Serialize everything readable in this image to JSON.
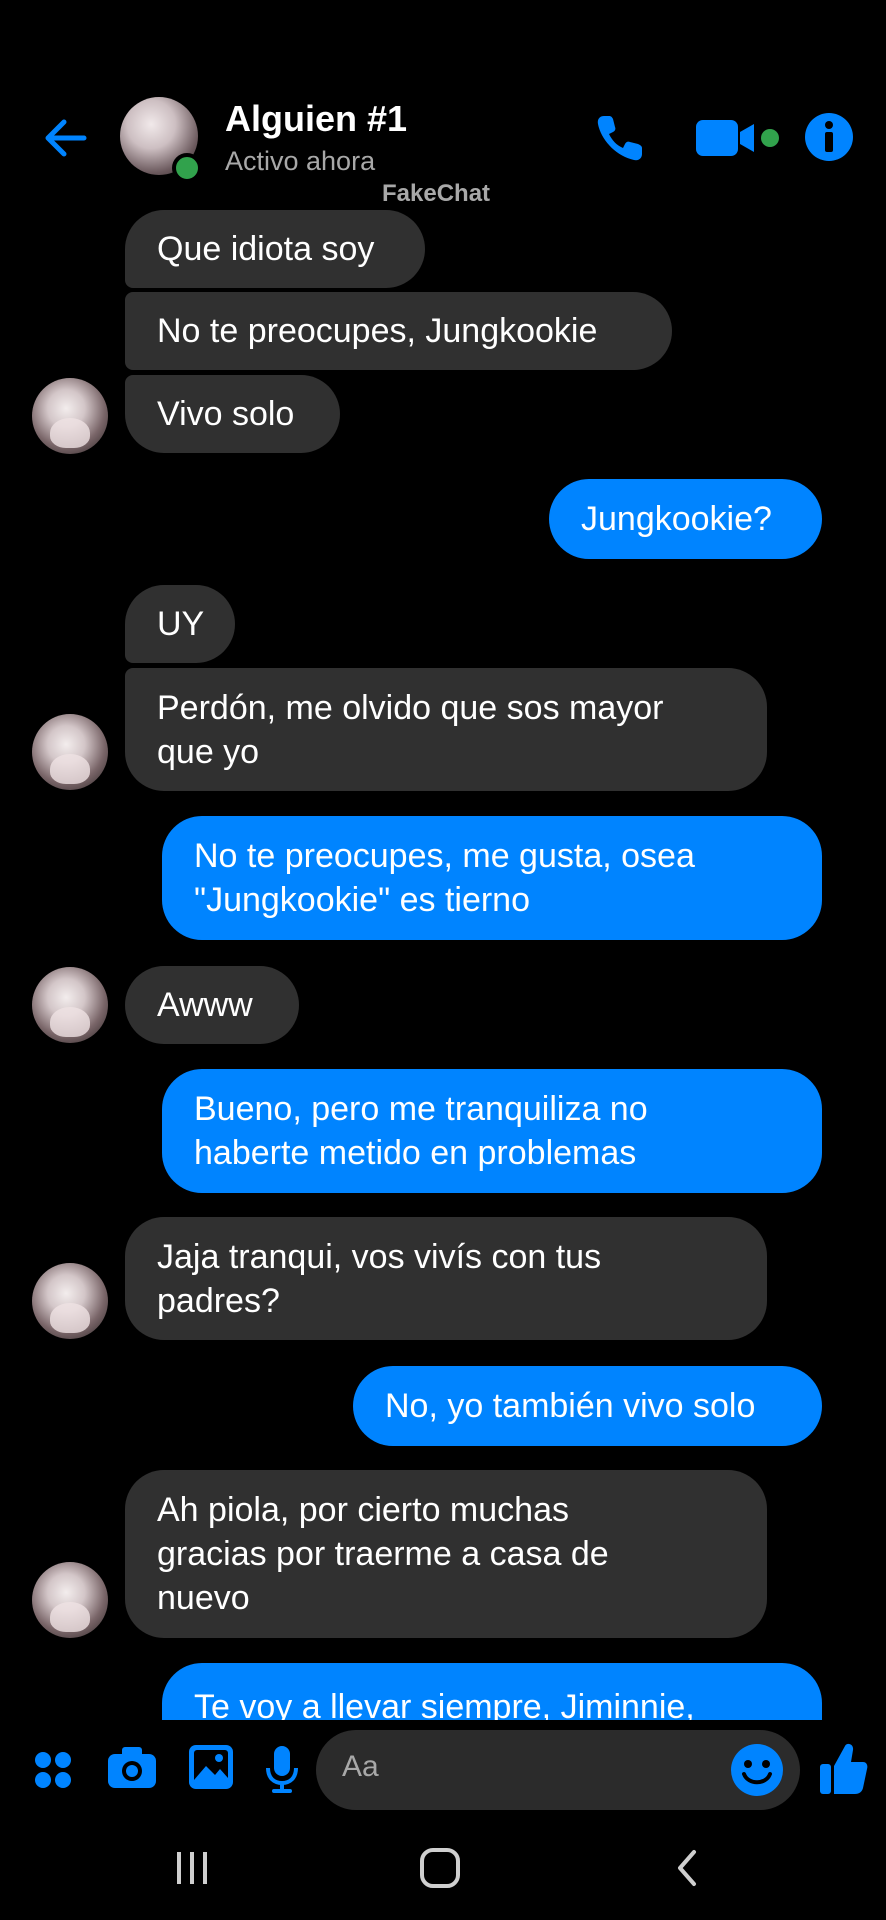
{
  "header": {
    "name": "Alguien #1",
    "status": "Activo ahora",
    "watermark": "FakeChat"
  },
  "messages": [
    {
      "from": "them",
      "text": "Que idiota soy"
    },
    {
      "from": "them",
      "text": "No te preocupes, Jungkookie"
    },
    {
      "from": "them",
      "text": "Vivo solo"
    },
    {
      "from": "me",
      "text": "Jungkookie?"
    },
    {
      "from": "them",
      "text": "UY"
    },
    {
      "from": "them",
      "lines": [
        "Perdón, me olvido que sos mayor",
        "que yo"
      ]
    },
    {
      "from": "me",
      "lines": [
        "No te preocupes, me gusta, osea",
        "\"Jungkookie\" es tierno"
      ]
    },
    {
      "from": "them",
      "text": "Awww"
    },
    {
      "from": "me",
      "lines": [
        "Bueno, pero me tranquiliza no",
        "haberte metido en problemas"
      ]
    },
    {
      "from": "them",
      "lines": [
        "Jaja tranqui, vos vivís con tus",
        "padres?"
      ]
    },
    {
      "from": "me",
      "text": "No, yo también vivo solo"
    },
    {
      "from": "them",
      "lines": [
        "Ah piola, por cierto muchas",
        "gracias por traerme a casa de",
        "nuevo"
      ]
    },
    {
      "from": "me",
      "text": "Te voy a llevar siempre, Jiminnie,"
    }
  ],
  "composer": {
    "placeholder": "Aa"
  },
  "colors": {
    "accent": "#0084ff",
    "incoming_bubble": "#303030",
    "online": "#31a24c"
  }
}
